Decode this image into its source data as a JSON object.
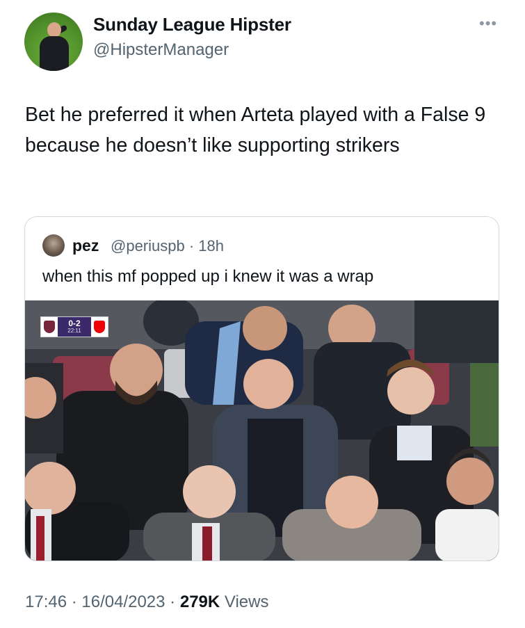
{
  "author": {
    "display_name": "Sunday League Hipster",
    "handle": "@HipsterManager"
  },
  "more_icon": "more-horizontal-icon",
  "tweet_text": "Bet he preferred it when Arteta played with a False 9 because he doesn’t like supporting strikers",
  "quoted": {
    "display_name": "pez",
    "handle_time": "@periuspb · 18h",
    "text": "when this mf popped up i knew it was a wrap",
    "scorebug": {
      "score": "0-2",
      "clock": "22:11"
    }
  },
  "meta": {
    "datetime": "17:46 · 16/04/2023 · ",
    "views_count": "279K",
    "views_label": " Views"
  },
  "colors": {
    "text_primary": "#0f1419",
    "text_secondary": "#536471",
    "border": "#cfd9de",
    "home_crest": "#7a263a",
    "away_crest": "#ef0107"
  }
}
